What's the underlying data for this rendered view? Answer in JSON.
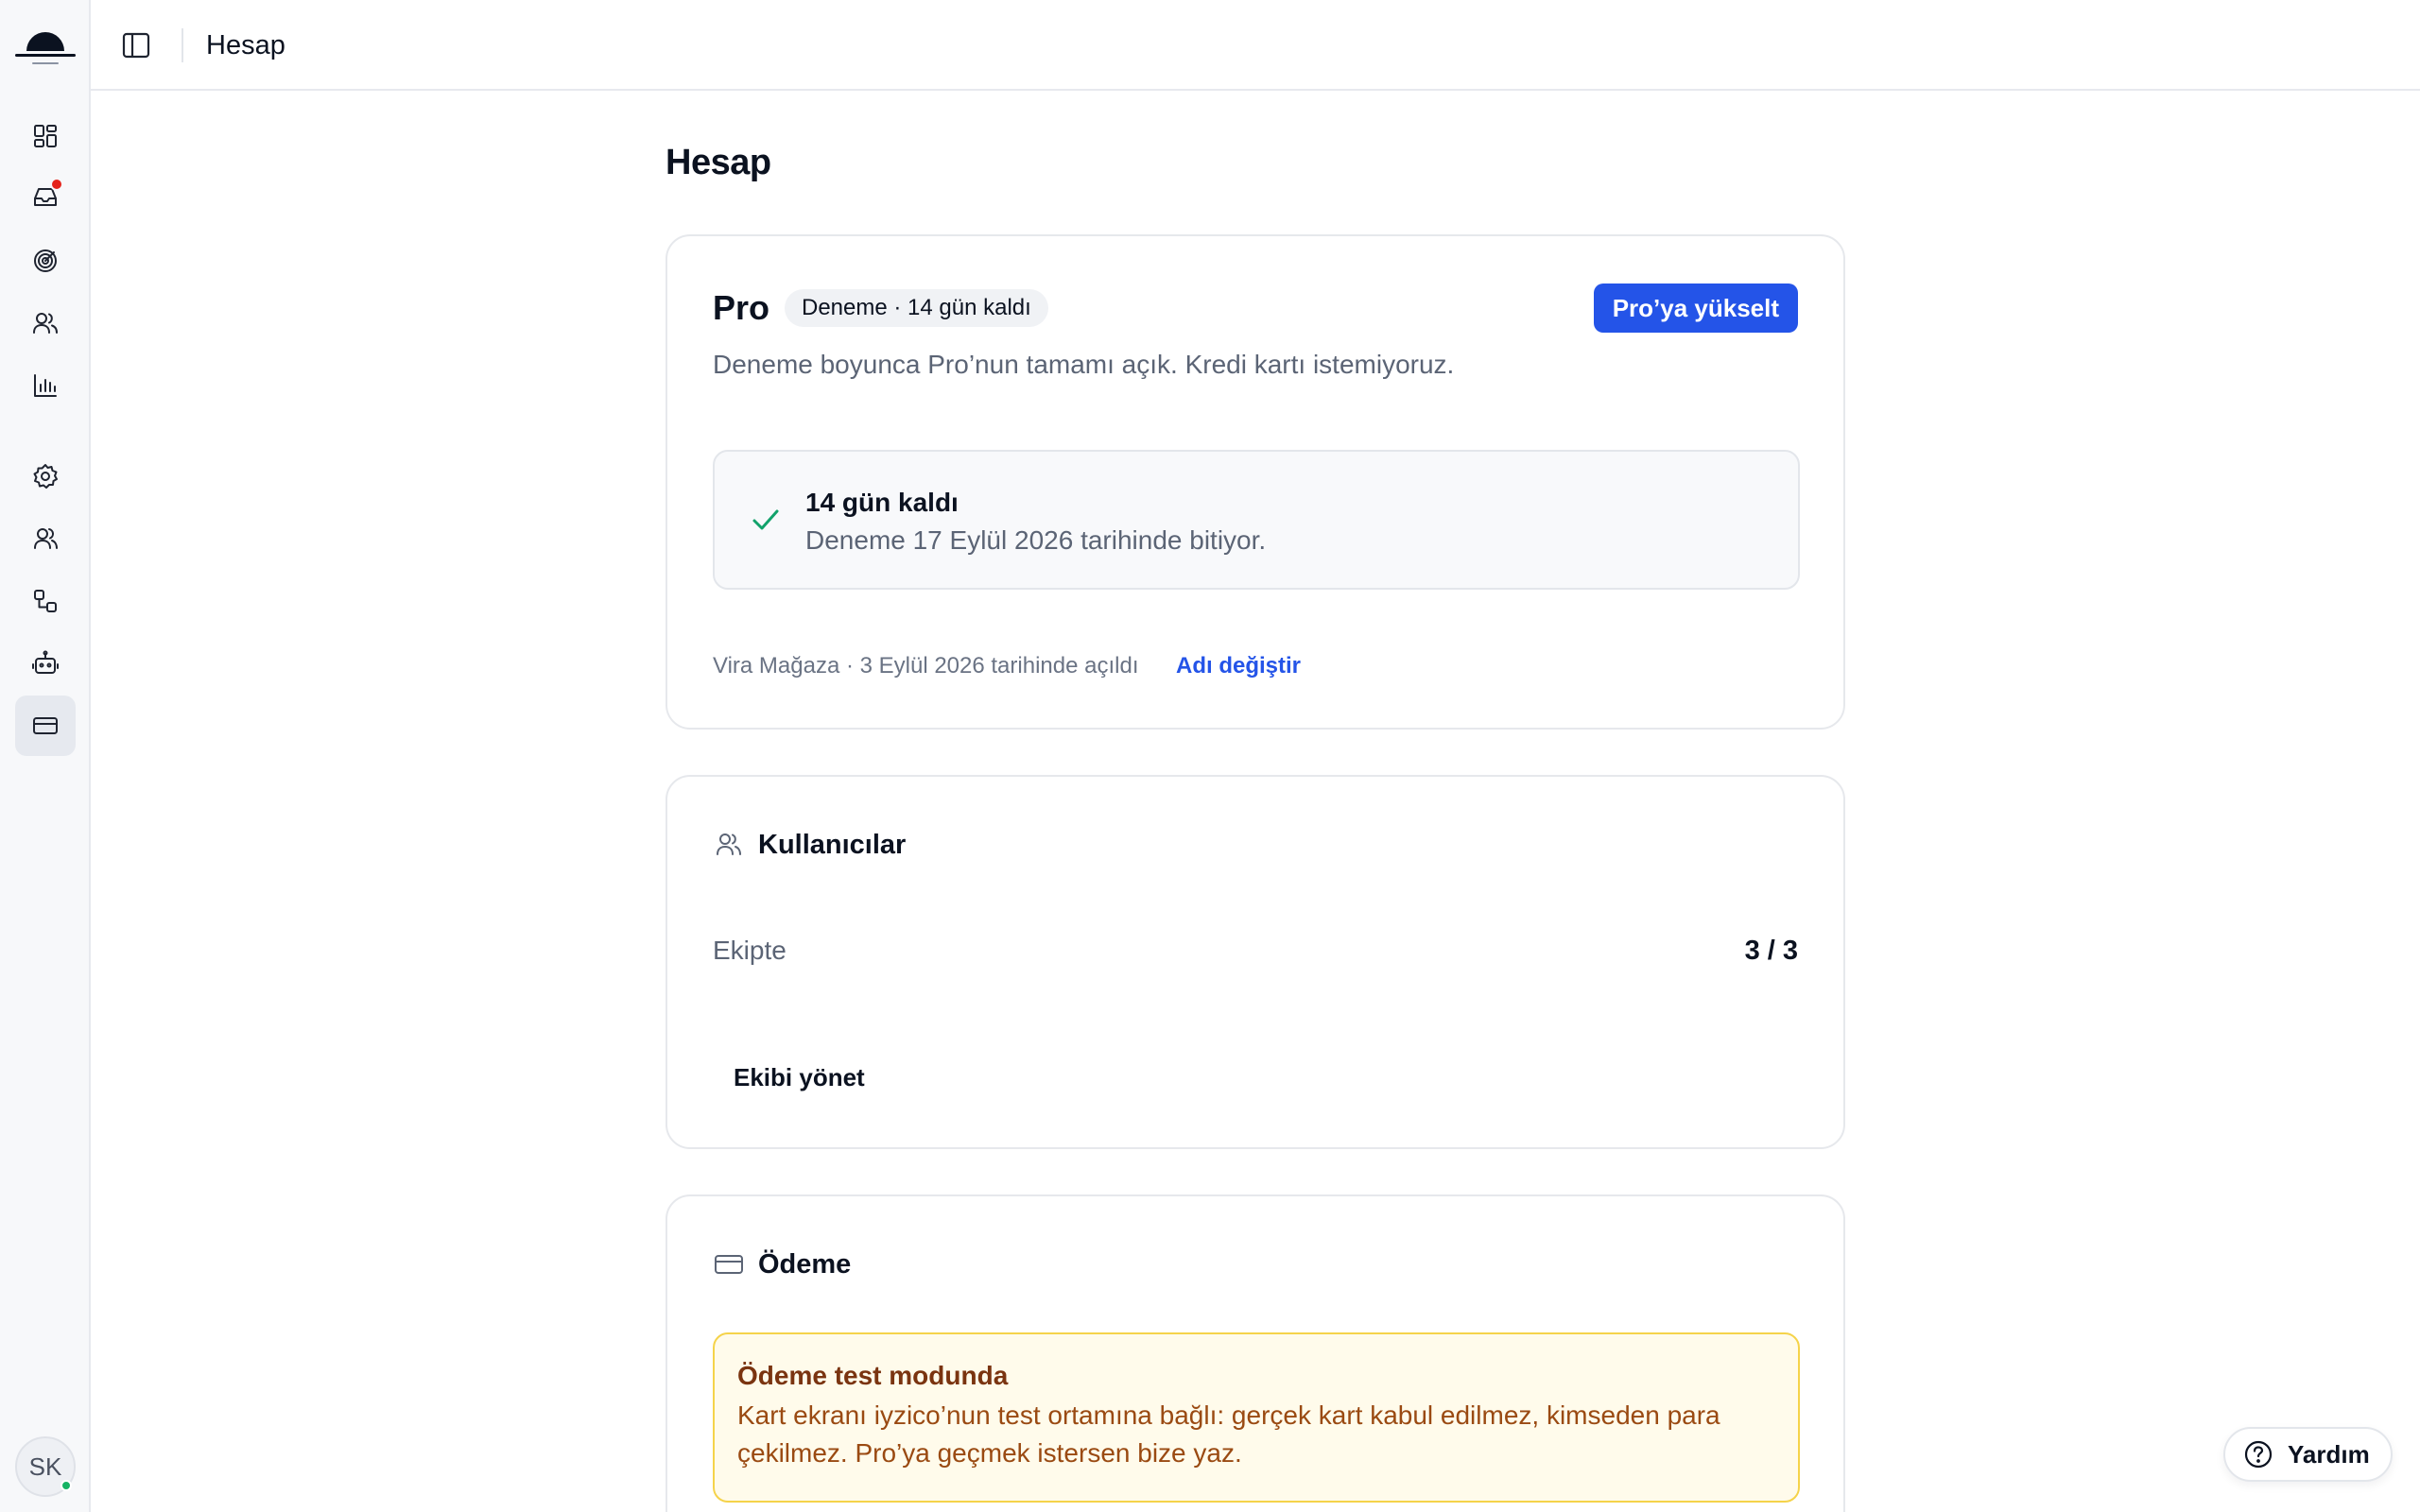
{
  "topbar": {
    "title": "Hesap"
  },
  "page": {
    "title": "Hesap"
  },
  "plan": {
    "name": "Pro",
    "badge": "Deneme · 14 gün kaldı",
    "upgrade_label": "Pro’ya yükselt",
    "description": "Deneme boyunca Pro’nun tamamı açık. Kredi kartı istemiyoruz.",
    "trial_left": "14 gün kaldı",
    "trial_end": "Deneme 17 Eylül 2026 tarihinde bitiyor.",
    "store_info": "Vira Mağaza · 3 Eylül 2026 tarihinde açıldı",
    "rename_label": "Adı değiştir"
  },
  "users": {
    "title": "Kullanıcılar",
    "label": "Ekipte",
    "count": "3 / 3",
    "manage_label": "Ekibi yönet"
  },
  "payment": {
    "title": "Ödeme",
    "warning_title": "Ödeme test modunda",
    "warning_text": "Kart ekranı iyzico’nun test ortamına bağlı: gerçek kart kabul edilmez, kimseden para çekilmez. Pro’ya geçmek istersen bize yaz."
  },
  "user": {
    "initials": "SK"
  },
  "help": {
    "label": "Yardım"
  },
  "sidebar": {
    "items": [
      {
        "icon": "dashboard-icon"
      },
      {
        "icon": "inbox-icon"
      },
      {
        "icon": "target-icon"
      },
      {
        "icon": "users-icon"
      },
      {
        "icon": "bar-chart-icon"
      },
      {
        "icon": "gear-icon"
      },
      {
        "icon": "team-icon"
      },
      {
        "icon": "integrations-icon"
      },
      {
        "icon": "bot-icon"
      },
      {
        "icon": "credit-card-icon"
      }
    ]
  },
  "colors": {
    "accent": "#2454e8",
    "success": "#12a26b",
    "warning_bg": "#fffbeb",
    "warning_border": "#f5d34a",
    "notification": "#e5231b"
  }
}
